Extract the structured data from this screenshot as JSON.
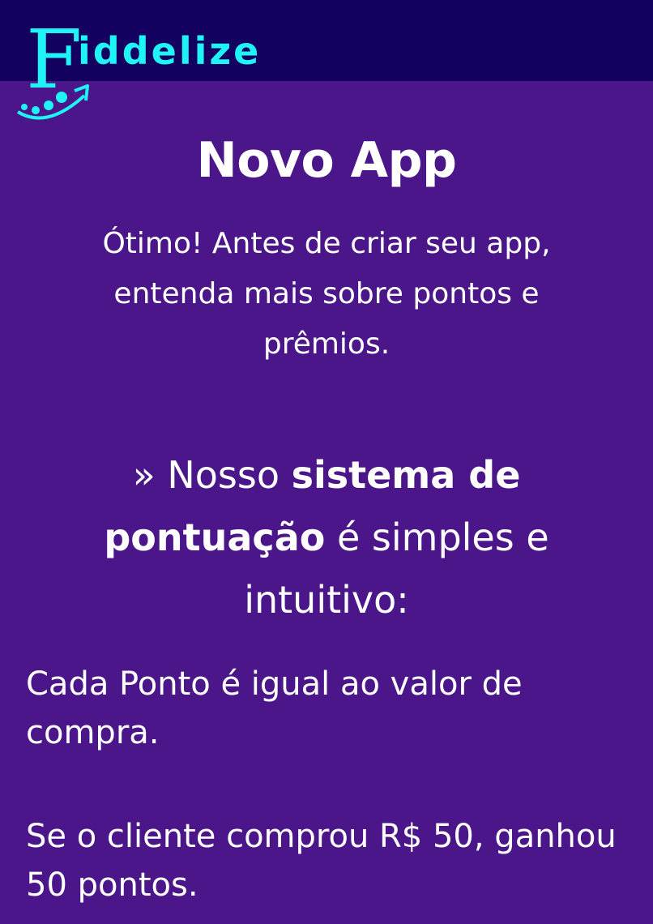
{
  "header": {
    "logo_text": "iddelize",
    "logo_initial": "F"
  },
  "main": {
    "title": "Novo App",
    "subtitle": "Ótimo! Antes de criar seu app, entenda mais sobre pontos e prêmios.",
    "heading": {
      "prefix": "» Nosso ",
      "bold1": "sistema de",
      "bold2": "pontuação",
      "suffix": " é simples e intuitivo:"
    },
    "paragraphs": [
      "Cada Ponto é igual ao valor de compra.",
      "Se o cliente comprou R$ 50, ganhou 50 pontos."
    ]
  },
  "colors": {
    "background": "#4a168a",
    "topbar": "#14005e",
    "logo": "#1ff3f6",
    "text": "#ffffff"
  }
}
